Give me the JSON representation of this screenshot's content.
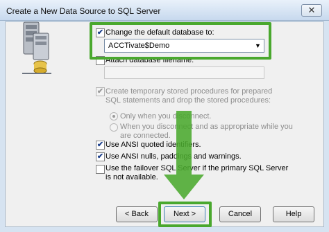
{
  "window": {
    "title": "Create a New Data Source to SQL Server",
    "close_glyph": "✕"
  },
  "options": {
    "change_default_db": {
      "label": "Change the default database to:",
      "checked": true
    },
    "database_value": "ACCTivate$Demo",
    "attach_db": {
      "label": "Attach database filename:",
      "checked": false
    },
    "attach_filename_value": "",
    "temp_procs": {
      "label": "Create temporary stored procedures for prepared SQL statements and drop the stored procedures:",
      "checked": true,
      "disabled": true
    },
    "radio_disconnect": {
      "label": "Only when you disconnect.",
      "selected": true
    },
    "radio_disconnect_appropriate": {
      "label": "When you disconnect and as appropriate while you are connected.",
      "selected": false
    },
    "ansi_quoted": {
      "label": "Use ANSI quoted identifiers.",
      "checked": true
    },
    "ansi_nulls": {
      "label": "Use ANSI nulls, paddings and warnings.",
      "checked": true
    },
    "failover": {
      "label": "Use the failover SQL Server if the primary SQL Server is not available.",
      "checked": false
    }
  },
  "buttons": {
    "back": "< Back",
    "next": "Next >",
    "cancel": "Cancel",
    "help": "Help"
  },
  "icons": {
    "check_glyph": "✔",
    "dropdown_glyph": "▼"
  },
  "colors": {
    "highlight": "#4aa82e",
    "title_bar": "#c7d9ee"
  }
}
